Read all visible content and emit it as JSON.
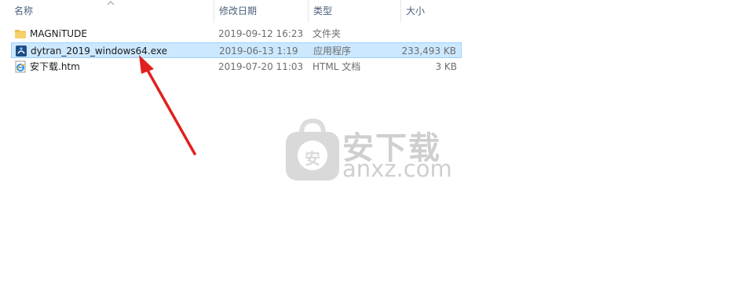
{
  "columns": {
    "name": "名称",
    "date": "修改日期",
    "type": "类型",
    "size": "大小"
  },
  "files": [
    {
      "name": "MAGNiTUDE",
      "date": "2019-09-12 16:23",
      "type": "文件夹",
      "size": "",
      "icon": "folder-icon",
      "selected": false
    },
    {
      "name": "dytran_2019_windows64.exe",
      "date": "2019-06-13 1:19",
      "type": "应用程序",
      "size": "233,493 KB",
      "icon": "installer-icon",
      "selected": true
    },
    {
      "name": "安下载.htm",
      "date": "2019-07-20 11:03",
      "type": "HTML 文档",
      "size": "3 KB",
      "icon": "ie-html-icon",
      "selected": false
    }
  ],
  "watermark": {
    "cn": "安下载",
    "en": "anxz.com",
    "badge": "安"
  },
  "colors": {
    "selection": "#cce8ff",
    "arrow": "#e0201f"
  }
}
